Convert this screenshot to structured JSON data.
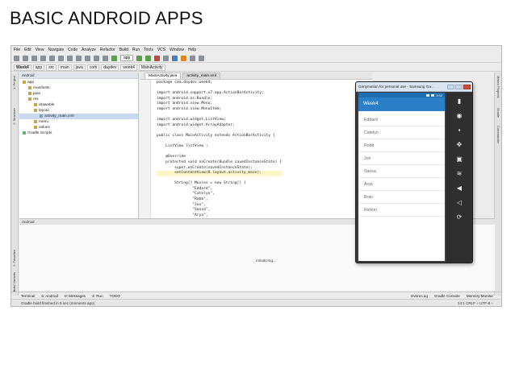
{
  "slide": {
    "title": "BASIC ANDROID APPS"
  },
  "ide": {
    "menu": [
      "File",
      "Edit",
      "View",
      "Navigate",
      "Code",
      "Analyze",
      "Refactor",
      "Build",
      "Run",
      "Tools",
      "VCS",
      "Window",
      "Help"
    ],
    "toolbar": {
      "run_config": "app"
    },
    "breadcrumb": [
      "Week4",
      "app",
      "src",
      "main",
      "java",
      "com",
      "daydev",
      "week4",
      "MainActivity"
    ],
    "project_panel": {
      "header": "Android",
      "tree": [
        {
          "label": "app",
          "indent": 0,
          "kind": "folder"
        },
        {
          "label": "manifests",
          "indent": 1,
          "kind": "folder"
        },
        {
          "label": "java",
          "indent": 1,
          "kind": "folder"
        },
        {
          "label": "res",
          "indent": 1,
          "kind": "folder"
        },
        {
          "label": "drawable",
          "indent": 2,
          "kind": "folder"
        },
        {
          "label": "layout",
          "indent": 2,
          "kind": "folder"
        },
        {
          "label": "activity_main.xml",
          "indent": 3,
          "kind": "file"
        },
        {
          "label": "menu",
          "indent": 2,
          "kind": "folder"
        },
        {
          "label": "values",
          "indent": 2,
          "kind": "folder"
        },
        {
          "label": "Gradle Scripts",
          "indent": 0,
          "kind": "gradle"
        }
      ]
    },
    "editor": {
      "tabs": [
        "MainActivity.java",
        "activity_main.xml"
      ],
      "code": [
        "package com.daydev.week4;",
        "",
        "import android.support.v7.app.ActionBarActivity;",
        "import android.os.Bundle;",
        "import android.view.Menu;",
        "import android.view.MenuItem;",
        "",
        "import android.widget.ListView;",
        "import android.widget.ArrayAdapter;",
        "",
        "public class MainActivity extends ActionBarActivity {",
        "",
        "    ListView listView ;",
        "",
        "    @Override",
        "    protected void onCreate(Bundle savedInstanceState) {",
        "        super.onCreate(savedInstanceState);",
        "        setContentView(R.layout.activity_main);",
        "",
        "        String[] Movies = new String[] {",
        "                \"Eddard\",",
        "                \"Catelyn\",",
        "                \"Robb\",",
        "                \"Jon\",",
        "                \"Sansa\",",
        "                \"Arya\","
      ]
    },
    "bottom_panel": {
      "header": "Android",
      "status": "Initializing..."
    },
    "tool_tabs": [
      "Terminal",
      "6: Android",
      "0: Messages",
      "4: Run",
      "TODO"
    ],
    "tool_tabs_right": [
      "Event Log",
      "Gradle Console",
      "Memory Monitor"
    ],
    "left_vertical_tabs": [
      "1: Project",
      "2: Structure"
    ],
    "left_vertical_tabs_bottom": [
      "2: Favorites",
      "Build Variants"
    ],
    "right_vertical_tabs": [
      "Maven Projects",
      "Gradle",
      "Commander"
    ],
    "status_bar": {
      "message": "Gradle build finished in 9 sec (moments ago)",
      "position": "14:1   CRLF ÷  UTF-8 ÷"
    }
  },
  "emulator": {
    "window_title": "Genymotion for personal use - Samsung Ga...",
    "app_title": "Week4",
    "status_time": "3:32",
    "movies": [
      "Eddard",
      "Catelyn",
      "Robb",
      "Jon",
      "Sansa",
      "Arya",
      "Bran",
      "Rickon"
    ],
    "side_controls": [
      "battery-icon",
      "gps-icon",
      "camera-icon",
      "move-icon",
      "id-icon",
      "rss-icon",
      "volume-up-icon",
      "volume-down-icon",
      "rotate-icon"
    ],
    "accent": "#2a7fc6"
  }
}
